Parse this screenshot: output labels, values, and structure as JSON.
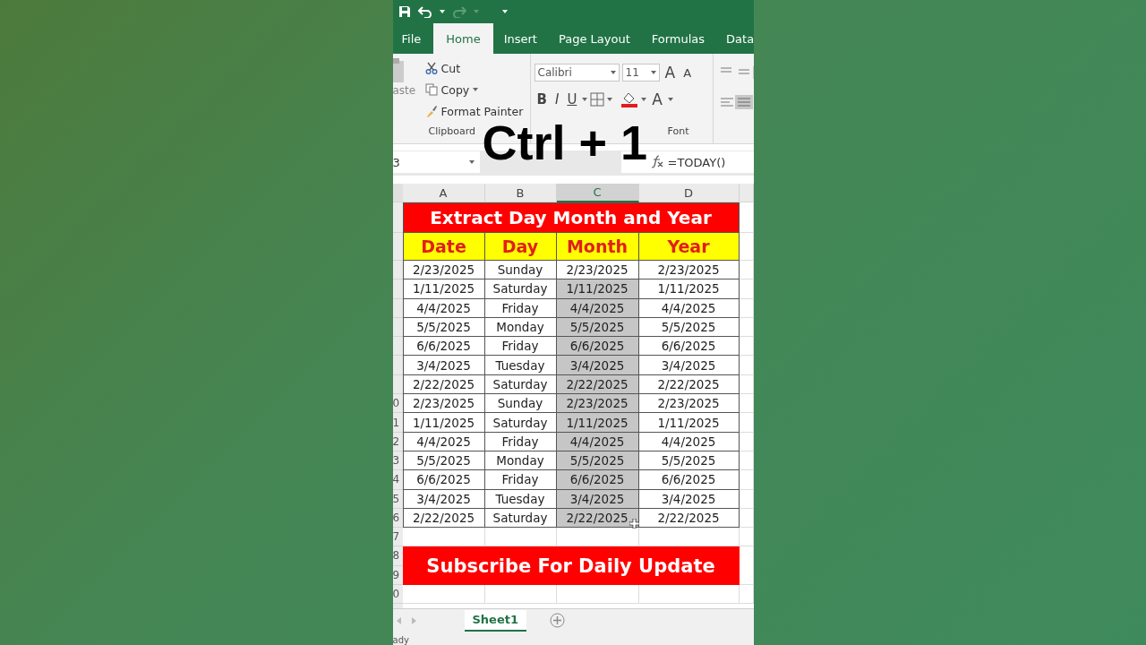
{
  "tabs": [
    {
      "label": "File",
      "selected": false
    },
    {
      "label": "Home",
      "selected": true
    },
    {
      "label": "Insert",
      "selected": false
    },
    {
      "label": "Page Layout",
      "selected": false
    },
    {
      "label": "Formulas",
      "selected": false
    },
    {
      "label": "Data",
      "selected": false
    }
  ],
  "clipboard": {
    "paste_label": "aste",
    "cut": "Cut",
    "copy": "Copy",
    "format_painter": "Format Painter",
    "group_label": "Clipboard"
  },
  "font": {
    "font_name": "Calibri",
    "font_size": "11",
    "grow": "A",
    "shrink": "A",
    "bold": "B",
    "italic": "I",
    "underline": "U",
    "font_color": "A",
    "group_label": "Font"
  },
  "overlay_text": "Ctrl + 1",
  "formula_bar": {
    "name_box": "3",
    "formula": "=TODAY()"
  },
  "columns": [
    {
      "label": "A",
      "selected": false
    },
    {
      "label": "B",
      "selected": false
    },
    {
      "label": "C",
      "selected": true
    },
    {
      "label": "D",
      "selected": false
    }
  ],
  "title": "Extract Day Month and Year",
  "headers": [
    "Date",
    "Day",
    "Month",
    "Year"
  ],
  "rows": [
    {
      "cells": [
        "2/23/2025",
        "Sunday",
        "2/23/2025",
        "2/23/2025"
      ],
      "selected": false
    },
    {
      "cells": [
        "1/11/2025",
        "Saturday",
        "1/11/2025",
        "1/11/2025"
      ],
      "selected": true
    },
    {
      "cells": [
        "4/4/2025",
        "Friday",
        "4/4/2025",
        "4/4/2025"
      ],
      "selected": true
    },
    {
      "cells": [
        "5/5/2025",
        "Monday",
        "5/5/2025",
        "5/5/2025"
      ],
      "selected": true
    },
    {
      "cells": [
        "6/6/2025",
        "Friday",
        "6/6/2025",
        "6/6/2025"
      ],
      "selected": true
    },
    {
      "cells": [
        "3/4/2025",
        "Tuesday",
        "3/4/2025",
        "3/4/2025"
      ],
      "selected": true
    },
    {
      "cells": [
        "2/22/2025",
        "Saturday",
        "2/22/2025",
        "2/22/2025"
      ],
      "selected": true
    },
    {
      "row_label": "0",
      "cells": [
        "2/23/2025",
        "Sunday",
        "2/23/2025",
        "2/23/2025"
      ],
      "selected": true
    },
    {
      "row_label": "1",
      "cells": [
        "1/11/2025",
        "Saturday",
        "1/11/2025",
        "1/11/2025"
      ],
      "selected": true
    },
    {
      "row_label": "2",
      "cells": [
        "4/4/2025",
        "Friday",
        "4/4/2025",
        "4/4/2025"
      ],
      "selected": true
    },
    {
      "row_label": "3",
      "cells": [
        "5/5/2025",
        "Monday",
        "5/5/2025",
        "5/5/2025"
      ],
      "selected": true
    },
    {
      "row_label": "4",
      "cells": [
        "6/6/2025",
        "Friday",
        "6/6/2025",
        "6/6/2025"
      ],
      "selected": true
    },
    {
      "row_label": "5",
      "cells": [
        "3/4/2025",
        "Tuesday",
        "3/4/2025",
        "3/4/2025"
      ],
      "selected": true
    },
    {
      "row_label": "6",
      "cells": [
        "2/22/2025",
        "Saturday",
        "2/22/2025",
        "2/22/2025"
      ],
      "selected": true
    }
  ],
  "after_rows": [
    {
      "kind": "blank",
      "row_label": "7"
    },
    {
      "kind": "banner",
      "row_labels": [
        "8",
        "9"
      ],
      "text": "Subscribe For Daily Update"
    },
    {
      "kind": "blank",
      "row_label": "0"
    }
  ],
  "sheet_tabs": [
    {
      "label": "Sheet1",
      "selected": true
    }
  ],
  "status_bar": "ady"
}
